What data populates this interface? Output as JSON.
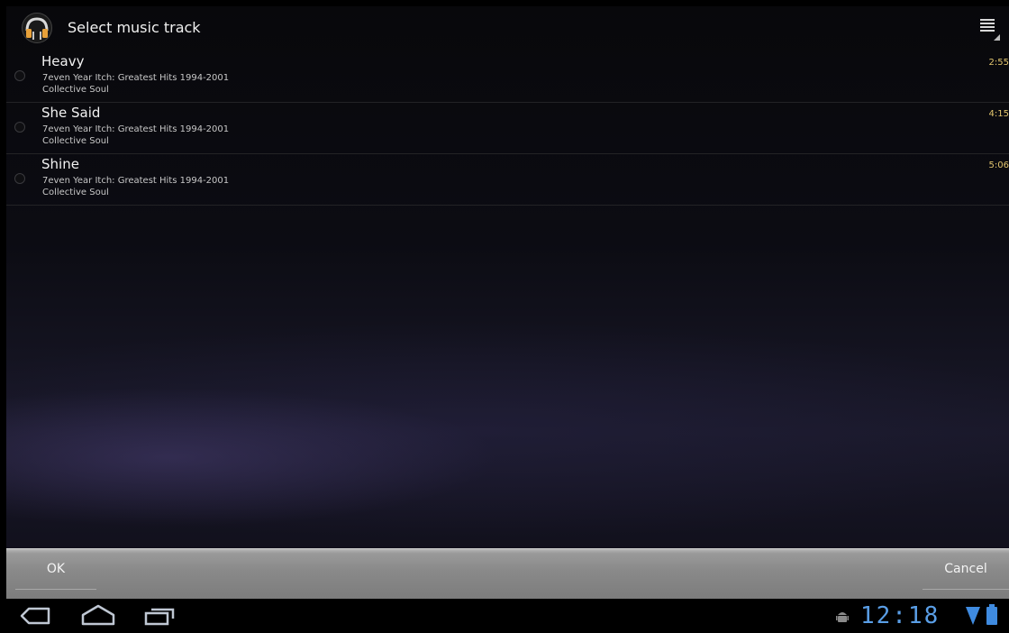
{
  "titlebar": {
    "title": "Select music track",
    "app_icon": "headphones-icon",
    "menu_icon": "overflow-menu-icon"
  },
  "tracks": [
    {
      "title": "Heavy",
      "album": "7even Year Itch: Greatest Hits 1994-2001",
      "artist": "Collective Soul",
      "duration": "2:55"
    },
    {
      "title": "She Said",
      "album": "7even Year Itch: Greatest Hits 1994-2001",
      "artist": "Collective Soul",
      "duration": "4:15"
    },
    {
      "title": "Shine",
      "album": "7even Year Itch: Greatest Hits 1994-2001",
      "artist": "Collective Soul",
      "duration": "5:06"
    }
  ],
  "buttons": {
    "ok_label": "OK",
    "cancel_label": "Cancel"
  },
  "system_bar": {
    "time": "12:18",
    "nav_icons": [
      "back-icon",
      "home-icon",
      "recent-apps-icon"
    ],
    "status_icons": [
      "android-debug-icon",
      "wifi-icon",
      "battery-icon"
    ]
  },
  "colors": {
    "duration": "#e1c46d",
    "clock": "#5a9ee6"
  }
}
